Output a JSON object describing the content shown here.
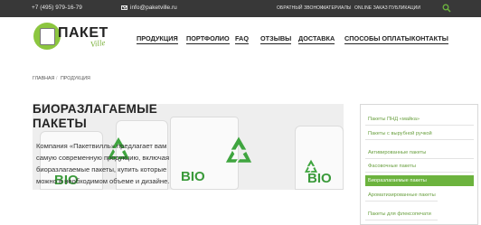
{
  "topbar": {
    "phone": "+7 (495) 979-16-79",
    "email": "info@paketville.ru",
    "links": [
      "ОБРАТНЫЙ ЗВОНОК",
      "МАТЕРИАЛЫ",
      "ONLINE ЗАКАЗ",
      "ПУБЛИКАЦИИ"
    ]
  },
  "logo": {
    "text": "ПАКЕТ",
    "script": "Ville"
  },
  "nav": [
    "ПРОДУКЦИЯ",
    "ПОРТФОЛИО",
    "FAQ",
    "ОТЗЫВЫ",
    "ДОСТАВКА",
    "СПОСОБЫ ОПЛАТЫ",
    "КОНТАКТЫ"
  ],
  "breadcrumb": [
    "ГЛАВНАЯ",
    "ПРОДУКЦИЯ"
  ],
  "hero": {
    "title_line1": "БИОРАЗЛАГАЕМЫЕ",
    "title_line2": "ПАКЕТЫ",
    "text_lines": [
      "Компания «Пакетвилль» предлагает вам",
      "самую современную продукцию, включая",
      "биоразлагаемые пакеты, купить которые",
      "можно в необходимом объеме и дизайне."
    ],
    "bio_label": "BIO"
  },
  "sidebar": {
    "items": [
      "Пакеты ПНД «майка»",
      "Пакеты с вырубной ручкой",
      "Активированные пакеты",
      "Фасовочные пакеты",
      "Биоразлагаемые пакеты",
      "Ароматизированные пакеты",
      "Пакеты для флексопечати"
    ],
    "active_index": 4
  },
  "colors": {
    "topbar": "#383838",
    "accent": "#6cb33e",
    "link": "#6aa040"
  },
  "icons": [
    "mail-icon",
    "search-icon",
    "recycle-icon"
  ]
}
